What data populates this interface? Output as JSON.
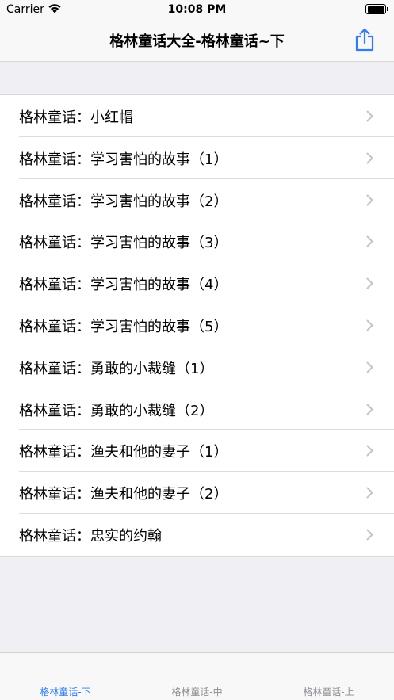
{
  "status_bar": {
    "carrier": "Carrier",
    "time": "10:08 PM"
  },
  "nav": {
    "title": "格林童话大全-格林童话~下",
    "share_icon": "share-icon"
  },
  "list": {
    "items": [
      {
        "label": "格林童话：小红帽"
      },
      {
        "label": "格林童话：学习害怕的故事（1）"
      },
      {
        "label": "格林童话：学习害怕的故事（2）"
      },
      {
        "label": "格林童话：学习害怕的故事（3）"
      },
      {
        "label": "格林童话：学习害怕的故事（4）"
      },
      {
        "label": "格林童话：学习害怕的故事（5）"
      },
      {
        "label": "格林童话：勇敢的小裁缝（1）"
      },
      {
        "label": "格林童话：勇敢的小裁缝（2）"
      },
      {
        "label": "格林童话：渔夫和他的妻子（1）"
      },
      {
        "label": "格林童话：渔夫和他的妻子（2）"
      },
      {
        "label": "格林童话：忠实的约翰"
      }
    ]
  },
  "tabs": [
    {
      "label": "格林童话-下",
      "active": true
    },
    {
      "label": "格林童话-中",
      "active": false
    },
    {
      "label": "格林童话-上",
      "active": false
    }
  ],
  "colors": {
    "accent": "#2f7cf6",
    "inactive": "#8e8e93"
  }
}
